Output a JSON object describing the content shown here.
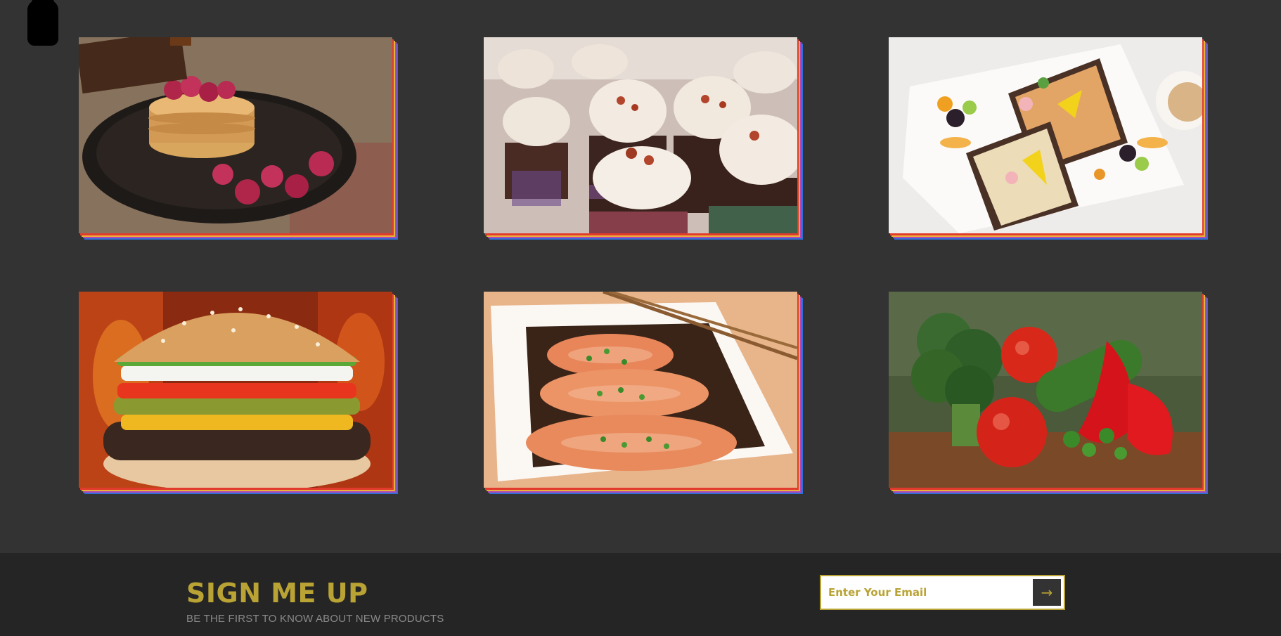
{
  "gallery": {
    "items": [
      {
        "subject": "pancakes-with-raspberries"
      },
      {
        "subject": "chocolate-cupcakes"
      },
      {
        "subject": "open-sandwiches-with-fruit"
      },
      {
        "subject": "cheeseburger"
      },
      {
        "subject": "salmon-steaks"
      },
      {
        "subject": "fresh-vegetables"
      }
    ]
  },
  "signup": {
    "title": "SIGN ME UP",
    "subtitle": "BE THE FIRST TO KNOW ABOUT NEW PRODUCTS",
    "email_placeholder": "Enter Your Email",
    "email_value": "",
    "submit_icon": "arrow-right-icon",
    "submit_glyph": "→"
  },
  "colors": {
    "background": "#333333",
    "footer": "#252525",
    "accent": "#b9a334",
    "frame_layers": [
      "#2f6fd6",
      "#b548b8",
      "#e8b23a",
      "#e23b2e"
    ]
  }
}
